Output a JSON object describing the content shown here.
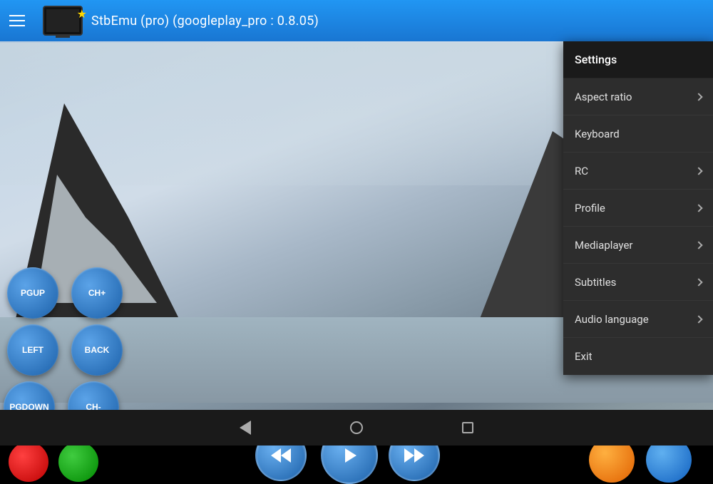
{
  "app": {
    "title": "StbEmu (pro) (googleplay_pro : 0.8.05)"
  },
  "menu": {
    "items": [
      {
        "id": "settings",
        "label": "Settings",
        "hasArrow": false
      },
      {
        "id": "aspect-ratio",
        "label": "Aspect ratio",
        "hasArrow": true
      },
      {
        "id": "keyboard",
        "label": "Keyboard",
        "hasArrow": false
      },
      {
        "id": "rc",
        "label": "RC",
        "hasArrow": true
      },
      {
        "id": "profile",
        "label": "Profile",
        "hasArrow": true
      },
      {
        "id": "mediaplayer",
        "label": "Mediaplayer",
        "hasArrow": true
      },
      {
        "id": "subtitles",
        "label": "Subtitles",
        "hasArrow": true
      },
      {
        "id": "audio-language",
        "label": "Audio language",
        "hasArrow": true
      },
      {
        "id": "exit",
        "label": "Exit",
        "hasArrow": false
      }
    ]
  },
  "controls": {
    "pgup": "PGUP",
    "chplus": "CH+",
    "left": "LEFT",
    "back": "BACK",
    "pgdown": "PGDOWN",
    "chminus": "CH-"
  },
  "systembar": {
    "back": "◁",
    "home": "○",
    "recent": "□"
  }
}
